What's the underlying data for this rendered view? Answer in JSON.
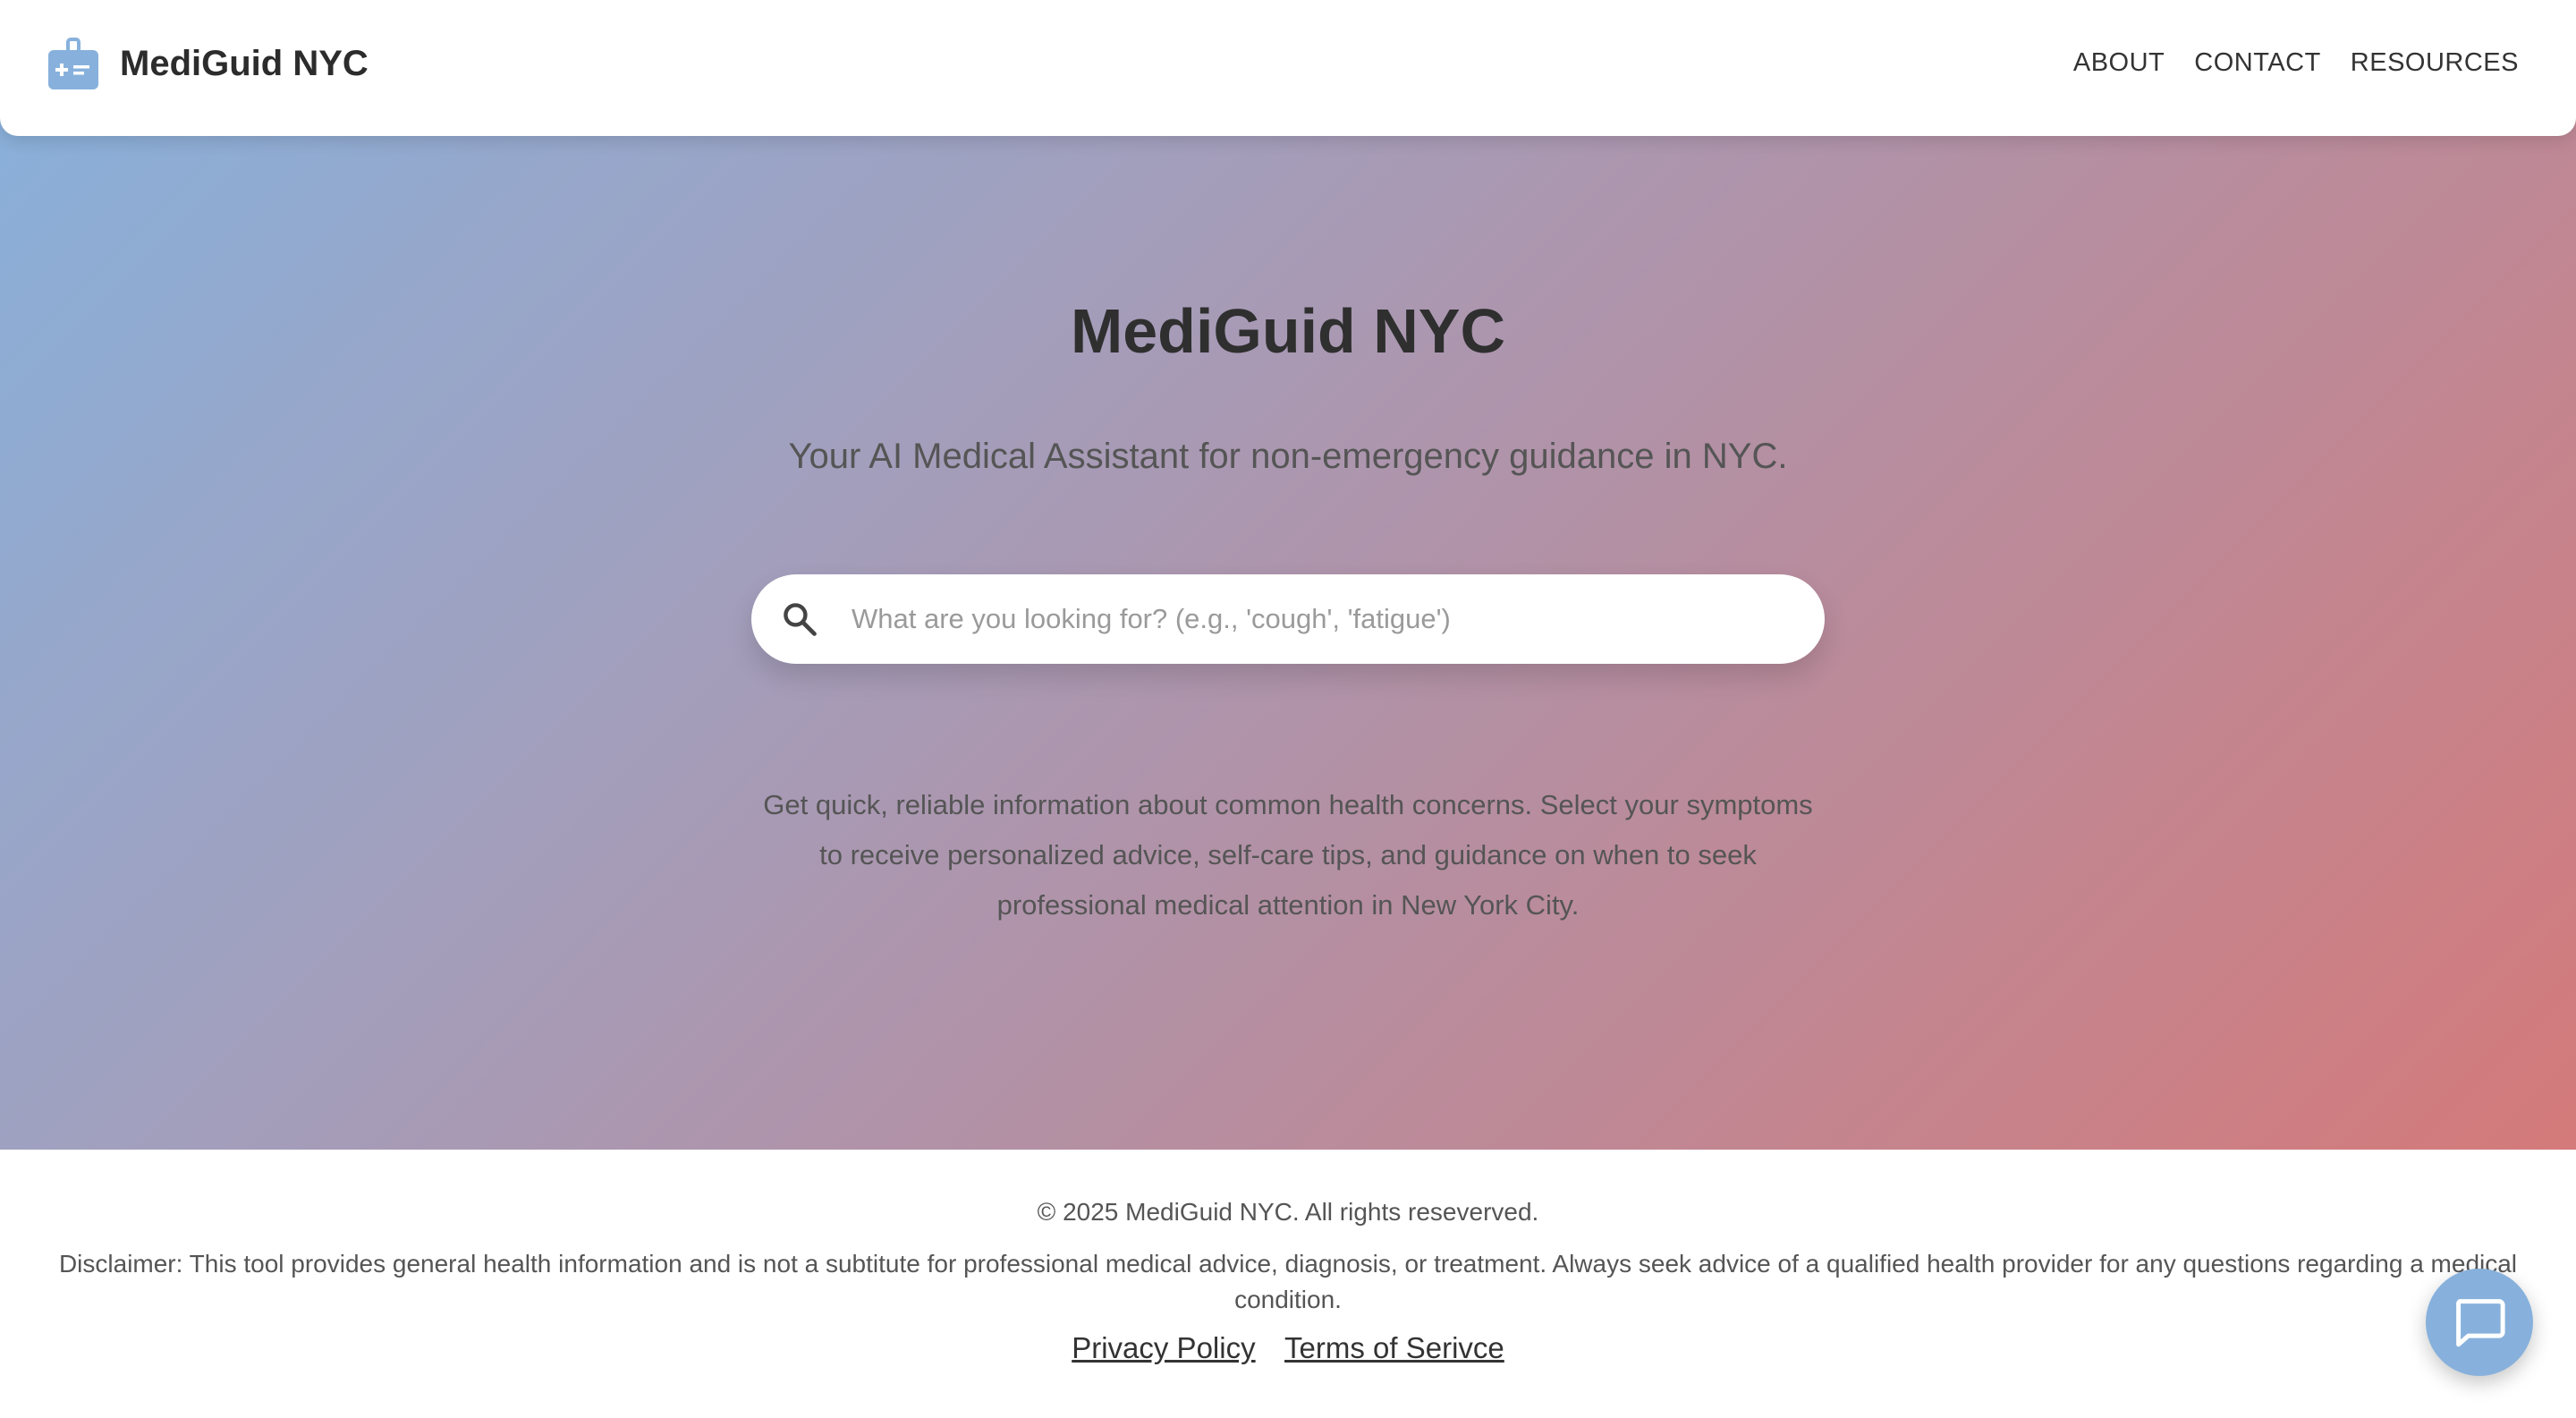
{
  "header": {
    "brand_name": "MediGuid NYC",
    "brand_icon": "medical-kit-icon",
    "nav": [
      {
        "label": "ABOUT"
      },
      {
        "label": "CONTACT"
      },
      {
        "label": "RESOURCES"
      }
    ]
  },
  "hero": {
    "title": "MediGuid NYC",
    "subtitle": "Your AI Medical Assistant for non-emergency guidance in NYC.",
    "search": {
      "placeholder": "What are you looking for? (e.g., 'cough', 'fatigue')",
      "value": "",
      "icon": "search-icon"
    },
    "description": "Get quick, reliable information about common health concerns. Select your symptoms to receive personalized advice, self-care tips, and guidance on when to seek professional medical attention in New York City."
  },
  "footer": {
    "copyright": "© 2025 MediGuid NYC. All rights reseverved.",
    "disclaimer": "Disclaimer: This tool provides general health information and is not a subtitute for professional medical advice, diagnosis, or treatment. Always seek advice of a qualified health provider for any questions regarding a medical condition.",
    "links": [
      {
        "label": "Privacy Policy"
      },
      {
        "label": "Terms of Serivce"
      }
    ]
  },
  "chat": {
    "icon": "chat-bubble-icon"
  },
  "colors": {
    "accent": "#87b1dc",
    "gradient_start": "#87b1dc",
    "gradient_end": "#d47a7a",
    "title_text": "#2f2f2f",
    "body_text": "#555555"
  }
}
